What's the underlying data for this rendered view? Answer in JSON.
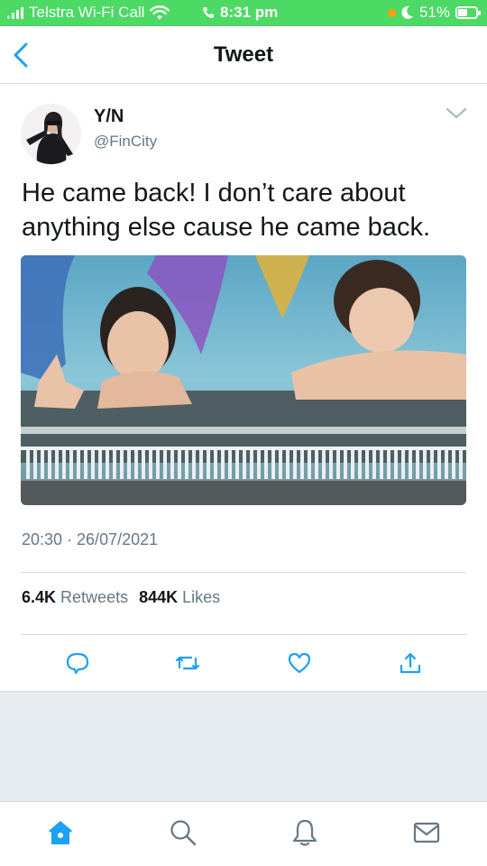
{
  "status_bar": {
    "carrier": "Telstra Wi-Fi Call",
    "time": "8:31 pm",
    "battery": "51%",
    "battery_level": 0.51,
    "color": "#4cd964"
  },
  "header": {
    "title": "Tweet",
    "back_icon": "chevron-left-icon"
  },
  "tweet": {
    "user_name": "Y/N",
    "handle": "@FinCity",
    "text": "He came back! I don’t care about anything else cause he came back.",
    "timestamp": "20:30 · 26/07/2021",
    "retweets_count": "6.4K",
    "retweets_label": "Retweets",
    "likes_count": "844K",
    "likes_label": "Likes",
    "actions": [
      "reply-icon",
      "retweet-icon",
      "like-icon",
      "share-icon"
    ]
  },
  "tabbar": {
    "tabs": [
      "home-icon",
      "search-icon",
      "notifications-icon",
      "messages-icon"
    ],
    "active": "home-icon"
  },
  "colors": {
    "accent": "#1da1f2",
    "text": "#14171a",
    "secondary": "#657786",
    "divider": "#d6dadf"
  }
}
